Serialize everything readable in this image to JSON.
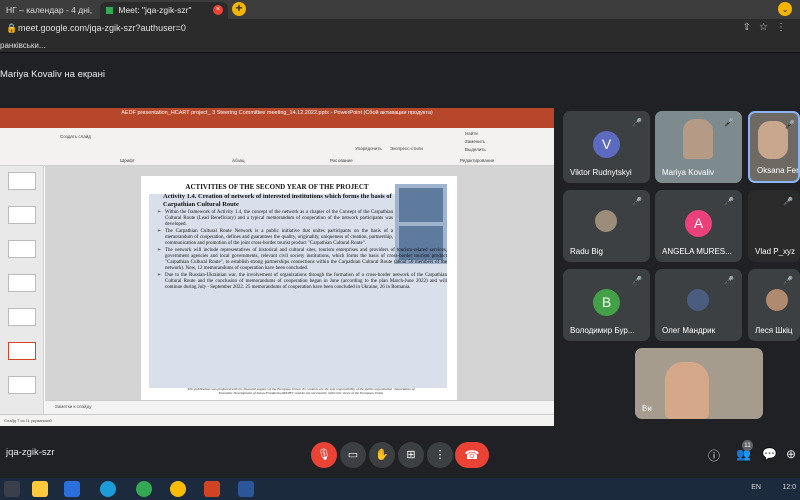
{
  "browser": {
    "tabs": [
      {
        "label": "НГ – календар - 4 дні, по...",
        "active": false
      },
      {
        "label": "Meet: \"jqa-zgik-szr\"",
        "active": true
      }
    ],
    "new_tab": "+",
    "url": "meet.google.com/jqa-zgik-szr?authuser=0",
    "bookmark": "ранківськи..."
  },
  "meet": {
    "presenter_label": "Mariya Kovaliv на екрані",
    "meeting_code": "jqa-zgik-szr",
    "people_count": "11"
  },
  "ppt": {
    "window_title": "AEDF presentation_HCART project_ 3 Steering Committee meeting_14.12.2022.pptx - PowerPoint (Сбой активации продукта)",
    "ribbon_tabs": [
      "Файл",
      "Вставка",
      "Дизайн",
      "Переходы",
      "Анимация",
      "Слайд-шоу",
      "Рецензирование",
      "Вид",
      "ACROBAT"
    ],
    "ribbon_labels": [
      "Создать слайд",
      "Шрифт",
      "Абзац",
      "Рисование",
      "Редактирование",
      "Найти",
      "Заменить",
      "Выделить",
      "Упорядочить",
      "Экспресс-стили"
    ],
    "notes_placeholder": "Заметки к слайду",
    "status": "Слайд 7 из 11   украинский"
  },
  "slide": {
    "heading": "ACTIVITIES OF THE SECOND YEAR OF THE PROJECT",
    "subheading": "Activity 1.4. Creation of network of interested institutions which forms the basis of Carpathian Cultural Route",
    "bullets": [
      "Within the framework of Activity 1.4, the concept of the network as a chapter of the Concept of the Carpathian Cultural Route (Lead Beneficiary) and a typical memorandum of cooperation of the network participants was developed.",
      "The Carpathian Cultural Route Network is a public initiative that unites participants on the basis of a memorandum of cooperation, defines and guarantees the quality, originality, uniqueness of creation, partnership, communication and promotion of the joint cross-border tourist product \"Carpathian Cultural Route\".",
      "The network will include representatives of historical and cultural sites, tourism enterprises and providers of tourism-related services, government agencies and local governments, relevant civil society institutions, which forms the basis of cross-border tourism product \"Carpathian Cultural Route\", to establish strong partnerships connections within the Carpathian Cultural Route (about 50 members of the network). Now, 12 memorandums of cooperation have been concluded.",
      "Due to the Russian-Ukrainian war, the involvement of organizations through the formation of a cross-border network of the Carpathian Cultural Route and the conclusion of memorandums of cooperation began in June (according to the plan March-June 2022) and will continue during July - September 2022. 25 memorandums of cooperation have been concluded in Ukraine, 26 in Romania."
    ],
    "footer": "This publication was produced with the financial support of the European Union. Its contents are the sole responsibility of the public organization \"Association of Economic Development of Ivano-Frankivsk (AEDIF)\" and do not necessarily reflect the views of the European Union"
  },
  "participants": [
    {
      "name": "Viktor Rudnytskyi",
      "type": "avatar",
      "initial": "V",
      "color": "#5c6bc0"
    },
    {
      "name": "Mariya Kovaliv",
      "type": "video",
      "color": "#8a7f74"
    },
    {
      "name": "Oksana Fer",
      "type": "video",
      "color": "#6e6a63"
    },
    {
      "name": "Radu Big",
      "type": "photo",
      "color": "#9c8c7a"
    },
    {
      "name": "ANGELA MURES...",
      "type": "avatar",
      "initial": "A",
      "color": "#ec407a"
    },
    {
      "name": "Vlad P_xyz",
      "type": "video",
      "color": "#2a2a2a"
    },
    {
      "name": "Володимир Бур...",
      "type": "avatar",
      "initial": "В",
      "color": "#43a047"
    },
    {
      "name": "Олег Мандрик",
      "type": "photo",
      "color": "#4a5d80"
    },
    {
      "name": "Леся Шкіц",
      "type": "photo",
      "color": "#b08a6e"
    },
    {
      "name": "Ви",
      "type": "video",
      "color": "#a69c8e"
    }
  ],
  "taskbar": {
    "lang": "EN",
    "time": "12:0"
  }
}
